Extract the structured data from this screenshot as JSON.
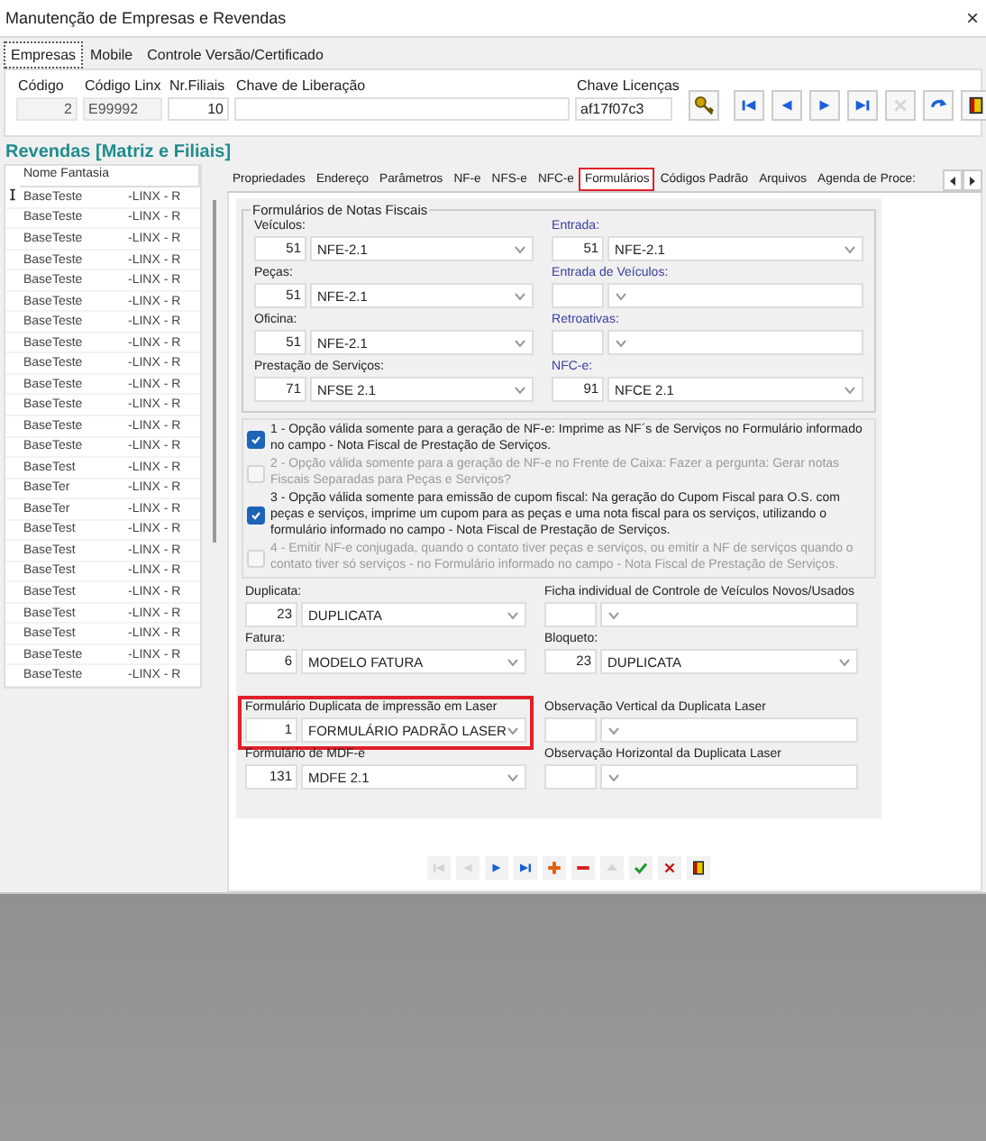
{
  "window": {
    "title": "Manutenção de Empresas e Revendas",
    "close": "×"
  },
  "top_tabs": [
    {
      "label": "Empresas",
      "selected": true
    },
    {
      "label": "Mobile",
      "selected": false
    },
    {
      "label": "Controle Versão/Certificado",
      "selected": false
    }
  ],
  "header_fields": [
    {
      "label": "Código",
      "value": "2",
      "disabled": true
    },
    {
      "label": "Código Linx",
      "value": "E99992",
      "disabled": true
    },
    {
      "label": "Nr.Filiais",
      "value": "10",
      "disabled": false
    },
    {
      "label": "Chave de Liberação",
      "disabled": false
    },
    {
      "label": "Chave Licenças",
      "value": "af17f07c3",
      "disabled": false
    }
  ],
  "toolbar": [
    {
      "kind": "key",
      "disabled": false
    },
    {
      "kind": "first",
      "disabled": false
    },
    {
      "kind": "prev",
      "disabled": false
    },
    {
      "kind": "next",
      "disabled": false
    },
    {
      "kind": "last",
      "disabled": false
    },
    {
      "kind": "cancel",
      "disabled": true
    },
    {
      "kind": "refresh",
      "disabled": false
    },
    {
      "kind": "exit",
      "disabled": false
    }
  ],
  "revendas": {
    "title": "Revendas [Matriz e Filiais]",
    "column": "Nome Fantasia",
    "rows": [
      {
        "name": "BaseTeste",
        "code": "-LINX - R",
        "current": true
      },
      {
        "name": "BaseTeste",
        "code": "-LINX - R",
        "current": false
      },
      {
        "name": "BaseTeste",
        "code": "-LINX - R",
        "current": false
      },
      {
        "name": "BaseTeste",
        "code": "-LINX - R",
        "current": false
      },
      {
        "name": "BaseTeste",
        "code": "-LINX - R",
        "current": false
      },
      {
        "name": "BaseTeste",
        "code": "-LINX - R",
        "current": false
      },
      {
        "name": "BaseTeste",
        "code": "-LINX - R",
        "current": false
      },
      {
        "name": "BaseTeste",
        "code": "-LINX - R",
        "current": false
      },
      {
        "name": "BaseTeste",
        "code": "-LINX - R",
        "current": false
      },
      {
        "name": "BaseTeste",
        "code": "-LINX - R",
        "current": false
      },
      {
        "name": "BaseTeste",
        "code": "-LINX - R",
        "current": false
      },
      {
        "name": "BaseTeste",
        "code": "-LINX - R",
        "current": false
      },
      {
        "name": "BaseTeste",
        "code": "-LINX - R",
        "current": false
      },
      {
        "name": "BaseTest",
        "code": "-LINX - R",
        "current": false
      },
      {
        "name": "BaseTer",
        "code": "-LINX - R",
        "current": false
      },
      {
        "name": "BaseTer",
        "code": "-LINX - R",
        "current": false
      },
      {
        "name": "BaseTest",
        "code": "-LINX - R",
        "current": false
      },
      {
        "name": "BaseTest",
        "code": "-LINX - R",
        "current": false
      },
      {
        "name": "BaseTest",
        "code": "-LINX - R",
        "current": false
      },
      {
        "name": "BaseTest",
        "code": "-LINX - R",
        "current": false
      },
      {
        "name": "BaseTest",
        "code": "-LINX - R",
        "current": false
      },
      {
        "name": "BaseTest",
        "code": "-LINX - R",
        "current": false
      },
      {
        "name": "BaseTeste",
        "code": "-LINX - R",
        "current": false
      },
      {
        "name": "BaseTeste",
        "code": "-LINX - R",
        "current": false
      }
    ]
  },
  "detail_tabs": [
    {
      "label": "Propriedades",
      "selected": false,
      "highlighted": false
    },
    {
      "label": "Endereço",
      "selected": false,
      "highlighted": false
    },
    {
      "label": "Parâmetros",
      "selected": false,
      "highlighted": false
    },
    {
      "label": "NF-e",
      "selected": false,
      "highlighted": false
    },
    {
      "label": "NFS-e",
      "selected": false,
      "highlighted": false
    },
    {
      "label": "NFC-e",
      "selected": false,
      "highlighted": false
    },
    {
      "label": "Formulários",
      "selected": true,
      "highlighted": true
    },
    {
      "label": "Códigos Padrão",
      "selected": false,
      "highlighted": false
    },
    {
      "label": "Arquivos",
      "selected": false,
      "highlighted": false
    },
    {
      "label": "Agenda de Proce:",
      "selected": false,
      "highlighted": false
    }
  ],
  "notas_fiscais": {
    "title": "Formulários de  Notas Fiscais",
    "rows": [
      {
        "left": {
          "label": "Veículos:",
          "code": "51",
          "value": "NFE-2.1"
        },
        "right": {
          "label": "Entrada:",
          "code": "51",
          "value": "NFE-2.1"
        }
      },
      {
        "left": {
          "label": "Peças:",
          "code": "51",
          "value": "NFE-2.1"
        },
        "right": {
          "label": "Entrada de Veículos:"
        }
      },
      {
        "left": {
          "label": "Oficina:",
          "code": "51",
          "value": "NFE-2.1"
        },
        "right": {
          "label": "Retroativas:"
        }
      },
      {
        "left": {
          "label": "Prestação de Serviços:",
          "code": "71",
          "value": "NFSE 2.1"
        },
        "right": {
          "label": "NFC-e:",
          "code": "91",
          "value": "NFCE 2.1"
        }
      }
    ]
  },
  "options": [
    {
      "text": "1 - Opção válida somente para a geração de NF-e:  Imprime as NF´s de Serviços no Formulário informado no campo - Nota Fiscal de Prestação de Serviços.",
      "checked": true,
      "disabled": false
    },
    {
      "text": "2 - Opção válida somente para a geração de NF-e no Frente de Caixa: Fazer a pergunta: Gerar notas Fiscais Separadas para Peças e Serviços?",
      "checked": false,
      "disabled": true
    },
    {
      "text": "3 - Opção válida somente para emissão de cupom fiscal: Na geração do Cupom Fiscal para O.S. com peças e serviços, imprime um cupom para as peças e uma nota fiscal para os serviços, utilizando o formulário informado no campo -  Nota Fiscal de Prestação de Serviços.",
      "checked": true,
      "disabled": false
    },
    {
      "text": "4 - Emitir NF-e conjugada, quando o contato tiver peças e serviços, ou emitir a NF de serviços quando o contato tiver só serviços - no Formulário informado no campo - Nota Fiscal de Prestação de Serviços.",
      "checked": false,
      "disabled": true
    }
  ],
  "lower_rows": [
    {
      "left": {
        "label": "Duplicata:",
        "code": "23",
        "value": "DUPLICATA",
        "highlighted": false
      },
      "right": {
        "label": "Ficha individual de Controle de Veículos Novos/Usados"
      }
    },
    {
      "left": {
        "label": "Fatura:",
        "code": "6",
        "value": "MODELO FATURA",
        "highlighted": false
      },
      "right": {
        "label": "Bloqueto:",
        "code": "23",
        "value": "DUPLICATA"
      }
    },
    {
      "left": {
        "label": "Formulário Duplicata de impressão em Laser",
        "code": "1",
        "value": "FORMULÁRIO PADRÃO LASER",
        "highlighted": true
      },
      "right": {
        "label": "Observação Vertical da Duplicata Laser"
      }
    },
    {
      "left": {
        "label": "Formulário de MDF-e",
        "code": "131",
        "value": "MDFE 2.1",
        "highlighted": false
      },
      "right": {
        "label": "Observação Horizontal da Duplicata Laser"
      }
    }
  ],
  "record_nav": [
    {
      "kind": "first",
      "disabled": true
    },
    {
      "kind": "prev",
      "disabled": true
    },
    {
      "kind": "next",
      "disabled": false
    },
    {
      "kind": "last",
      "disabled": false
    },
    {
      "kind": "add",
      "disabled": false
    },
    {
      "kind": "remove",
      "disabled": false
    },
    {
      "kind": "up",
      "disabled": true
    },
    {
      "kind": "confirm",
      "disabled": false
    },
    {
      "kind": "cancel",
      "disabled": false
    },
    {
      "kind": "exit",
      "disabled": false
    }
  ]
}
